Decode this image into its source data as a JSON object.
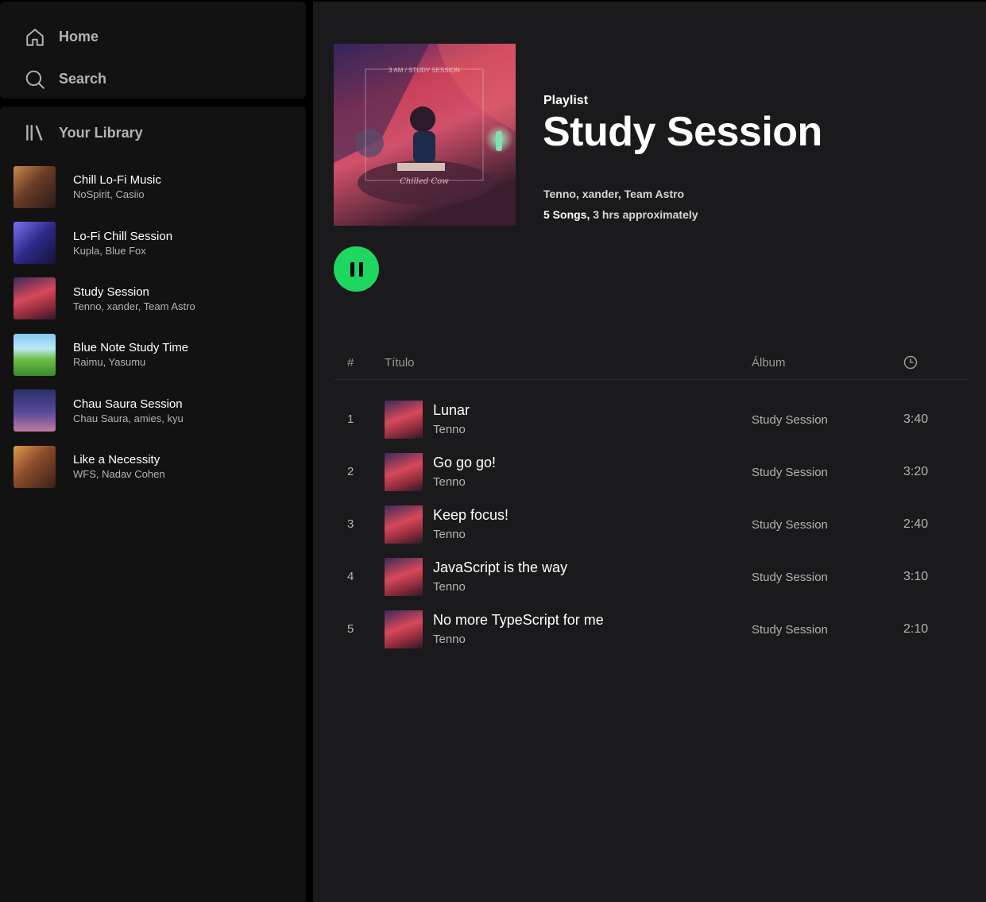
{
  "nav": {
    "home_label": "Home",
    "search_label": "Search"
  },
  "library": {
    "title": "Your Library",
    "items": [
      {
        "name": "Chill Lo-Fi Music",
        "artists": "NoSpirit, Casiio"
      },
      {
        "name": "Lo-Fi Chill Session",
        "artists": "Kupla, Blue Fox"
      },
      {
        "name": "Study Session",
        "artists": "Tenno, xander, Team Astro"
      },
      {
        "name": "Blue Note Study Time",
        "artists": "Raimu, Yasumu"
      },
      {
        "name": "Chau Saura Session",
        "artists": "Chau Saura, amies, kyu"
      },
      {
        "name": "Like a Necessity",
        "artists": "WFS, Nadav Cohen"
      }
    ]
  },
  "playlist": {
    "type_label": "Playlist",
    "title": "Study Session",
    "artists": "Tenno, xander, Team Astro",
    "song_count": "5 Songs,",
    "duration": " 3 hrs approximately",
    "cover_text_top": "3 AM  /  STUDY SESSION",
    "cover_text_bottom": "Chilled Cow"
  },
  "table": {
    "headers": {
      "number": "#",
      "title": "Título",
      "album": "Álbum",
      "duration_icon": "clock-icon"
    },
    "rows": [
      {
        "number": "1",
        "title": "Lunar",
        "artist": "Tenno",
        "album": "Study Session",
        "duration": "3:40"
      },
      {
        "number": "2",
        "title": "Go go go!",
        "artist": "Tenno",
        "album": "Study Session",
        "duration": "3:20"
      },
      {
        "number": "3",
        "title": "Keep focus!",
        "artist": "Tenno",
        "album": "Study Session",
        "duration": "2:40"
      },
      {
        "number": "4",
        "title": "JavaScript is the way",
        "artist": "Tenno",
        "album": "Study Session",
        "duration": "3:10"
      },
      {
        "number": "5",
        "title": "No more TypeScript for me",
        "artist": "Tenno",
        "album": "Study Session",
        "duration": "2:10"
      }
    ]
  },
  "colors": {
    "accent": "#1ed760",
    "background": "#000000",
    "panel": "#121212",
    "main": "#1a1a1c",
    "text_secondary": "#b3b3b3"
  }
}
